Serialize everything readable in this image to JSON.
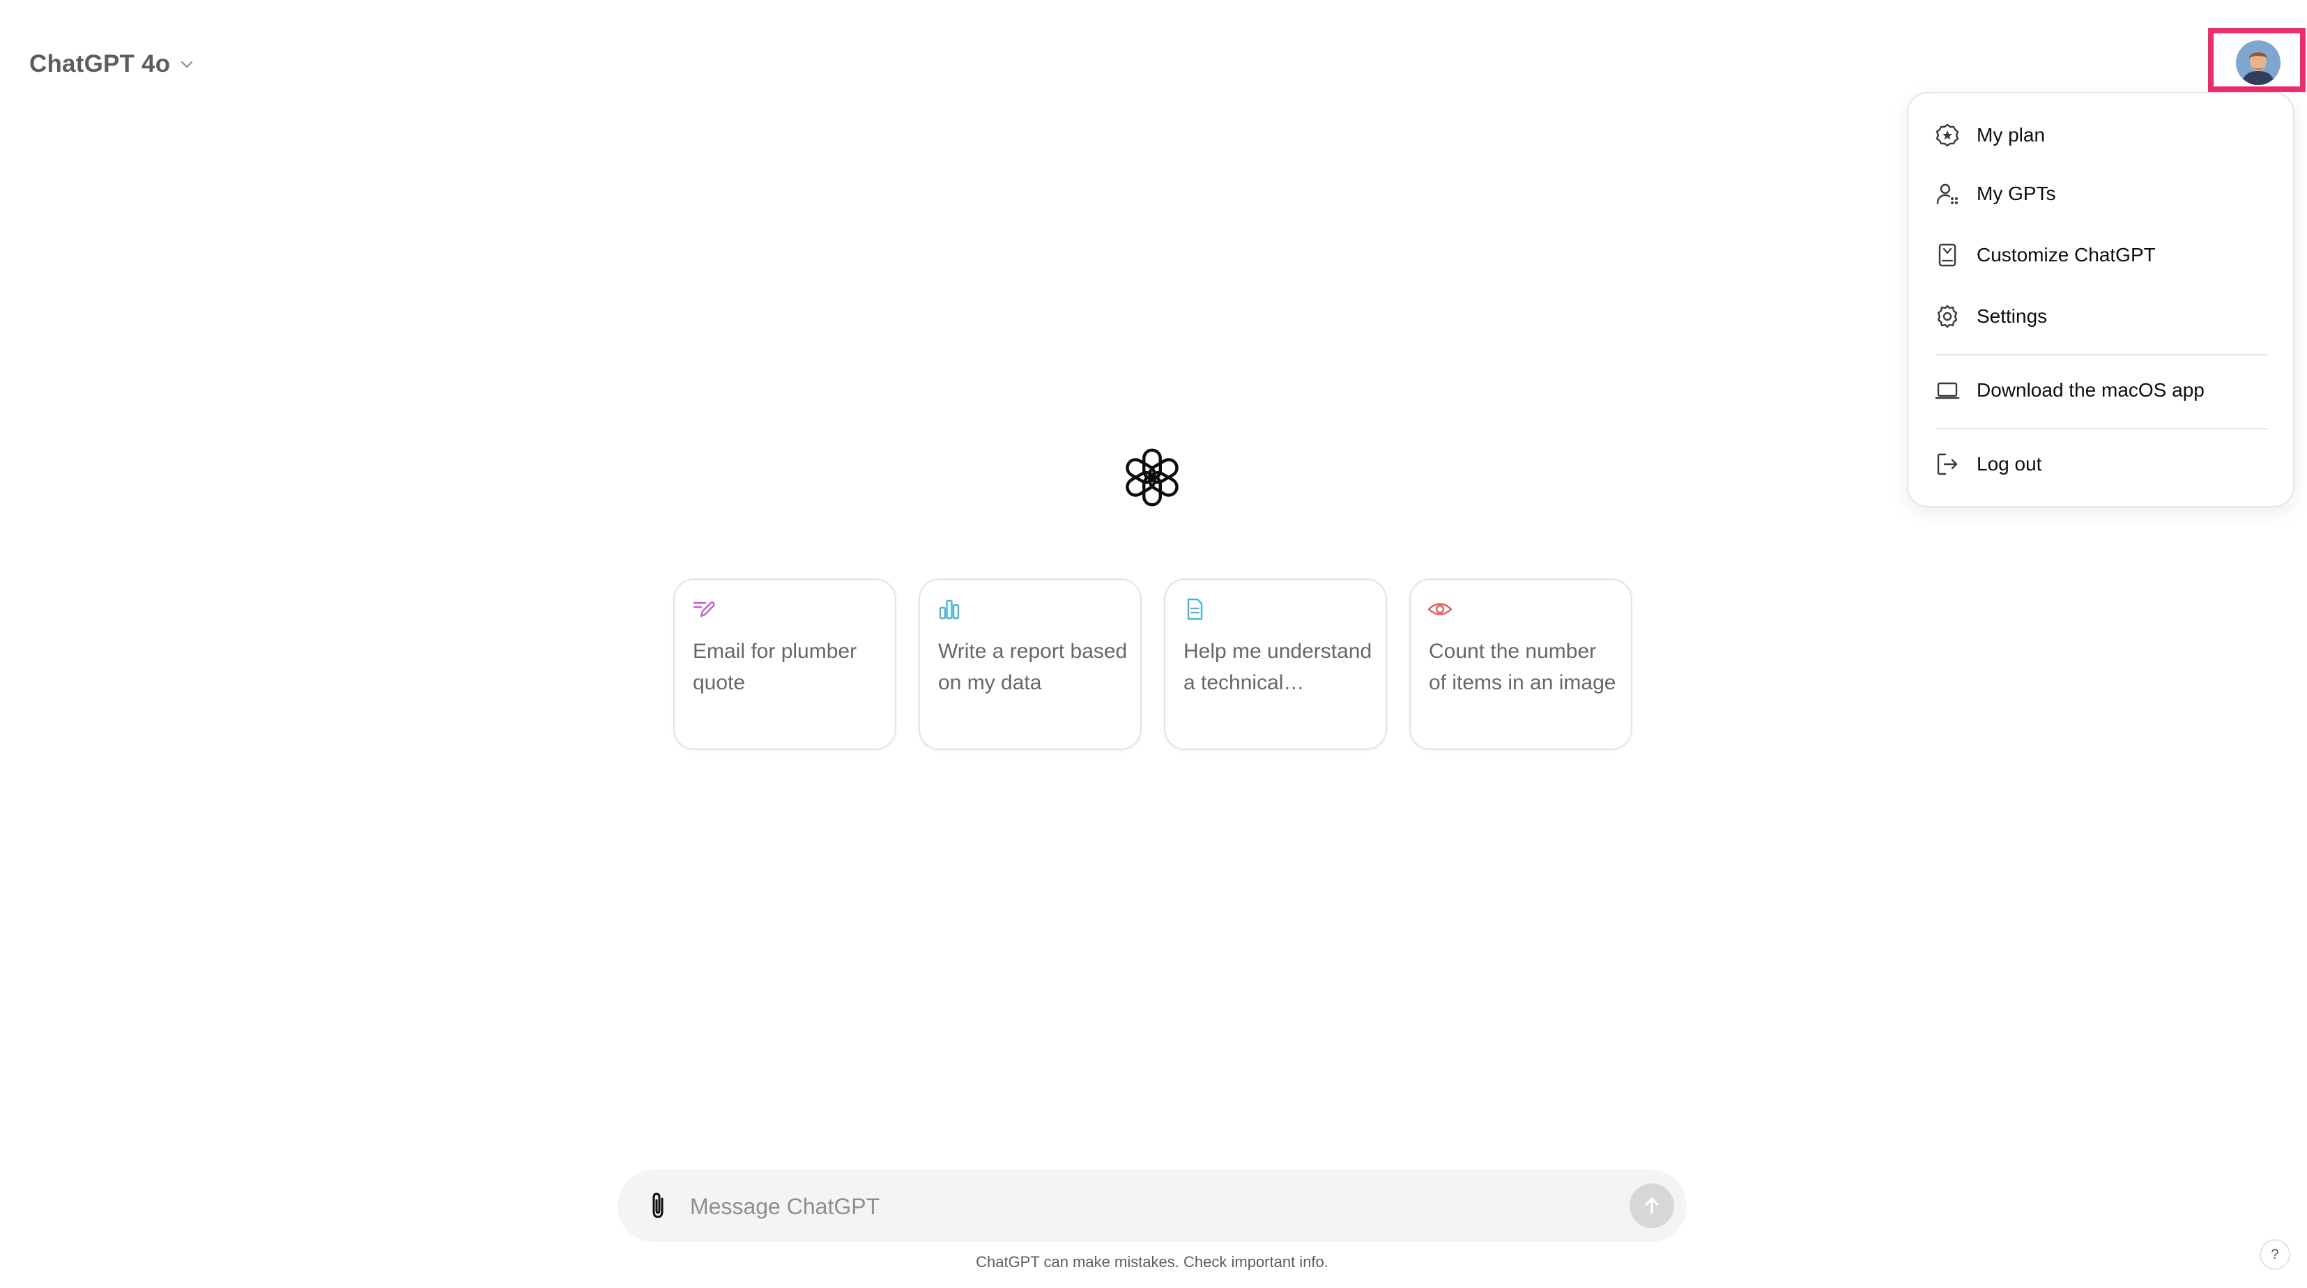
{
  "header": {
    "model_label": "ChatGPT 4o",
    "model_chevron_icon": "chevron-down-icon",
    "avatar_icon": "user-avatar"
  },
  "colors": {
    "highlight": "#ee2b6c",
    "email_icon": "#c061cb",
    "report_icon": "#4ab4d8",
    "doc_icon": "#4ab4d8",
    "eye_icon": "#e25e5e"
  },
  "account_menu": {
    "items": [
      {
        "label": "My plan",
        "icon": "plan-badge-icon"
      },
      {
        "label": "My GPTs",
        "icon": "gpts-icon"
      },
      {
        "label": "Customize ChatGPT",
        "icon": "customize-icon"
      },
      {
        "label": "Settings",
        "icon": "gear-icon"
      },
      {
        "label": "Download the macOS app",
        "icon": "laptop-icon"
      },
      {
        "label": "Log out",
        "icon": "logout-icon"
      }
    ]
  },
  "main": {
    "logo_icon": "openai-logo",
    "suggestions": [
      {
        "text": "Email for plumber quote",
        "icon": "pen-icon"
      },
      {
        "text": "Write a report based on my data",
        "icon": "bar-chart-icon"
      },
      {
        "text": "Help me understand a technical…",
        "icon": "document-icon"
      },
      {
        "text": "Count the number of items in an image",
        "icon": "eye-icon"
      }
    ]
  },
  "composer": {
    "placeholder": "Message ChatGPT",
    "value": "",
    "attach_icon": "paperclip-icon",
    "send_icon": "arrow-up-icon"
  },
  "footer": {
    "disclaimer": "ChatGPT can make mistakes. Check important info.",
    "help_label": "?"
  }
}
